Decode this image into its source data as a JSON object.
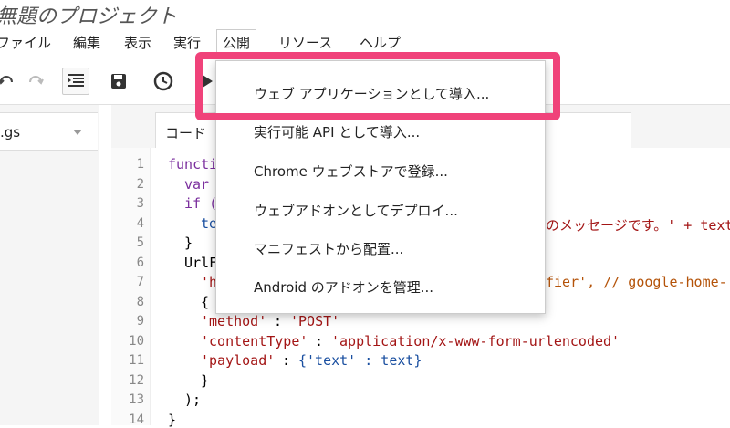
{
  "app": {
    "title": "無題のプロジェクト"
  },
  "menubar": {
    "items": [
      "ファイル",
      "編集",
      "表示",
      "実行",
      "公開",
      "リソース",
      "ヘルプ"
    ]
  },
  "sidebar": {
    "file_name": ".gs"
  },
  "editor": {
    "tab_label": "コード",
    "line_numbers": [
      "1",
      "2",
      "3",
      "4",
      "5",
      "6",
      "7",
      "8",
      "9",
      "10",
      "11",
      "12",
      "13",
      "14"
    ]
  },
  "code_lines": {
    "l1": "functi",
    "l2": "var",
    "l3": "if (",
    "l4_a": "te",
    "l4_b": "のメッセージです。' + text;",
    "l5": "}",
    "l6": "UrlF",
    "l7_a": "'h",
    "l7_b": "fier', // google-home-",
    "l8": "{",
    "l9_key": "'method'",
    "l9_val": "'POST'",
    "l10_key": "'contentType'",
    "l10_val": "'application/x-www-form-urlencoded'",
    "l11_key": "'payload'",
    "l11_val": "{'text' : text}",
    "l12": "}",
    "l13": ");",
    "l14": "}"
  },
  "publish_menu": {
    "items": [
      "ウェブ アプリケーションとして導入...",
      "実行可能 API として導入...",
      "Chrome ウェブストアで登録...",
      "ウェブアドオンとしてデプロイ...",
      "マニフェストから配置...",
      "Android のアドオンを管理..."
    ]
  },
  "colors": {
    "highlight": "#f0427a",
    "keyword": "#7b2f9e",
    "string": "#a31515"
  }
}
